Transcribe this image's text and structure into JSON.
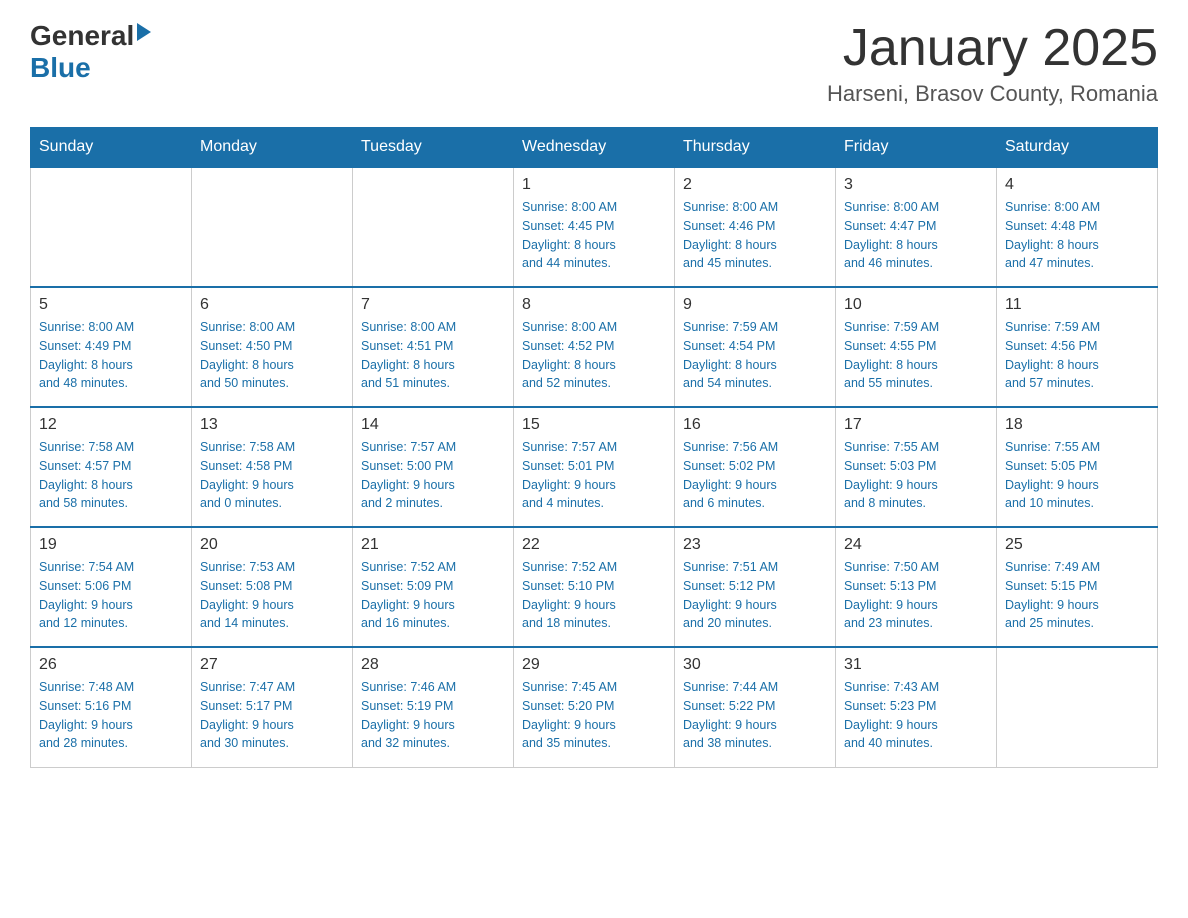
{
  "logo": {
    "general": "General",
    "blue": "Blue"
  },
  "title": "January 2025",
  "subtitle": "Harseni, Brasov County, Romania",
  "days_header": [
    "Sunday",
    "Monday",
    "Tuesday",
    "Wednesday",
    "Thursday",
    "Friday",
    "Saturday"
  ],
  "weeks": [
    [
      {
        "day": "",
        "info": ""
      },
      {
        "day": "",
        "info": ""
      },
      {
        "day": "",
        "info": ""
      },
      {
        "day": "1",
        "info": "Sunrise: 8:00 AM\nSunset: 4:45 PM\nDaylight: 8 hours\nand 44 minutes."
      },
      {
        "day": "2",
        "info": "Sunrise: 8:00 AM\nSunset: 4:46 PM\nDaylight: 8 hours\nand 45 minutes."
      },
      {
        "day": "3",
        "info": "Sunrise: 8:00 AM\nSunset: 4:47 PM\nDaylight: 8 hours\nand 46 minutes."
      },
      {
        "day": "4",
        "info": "Sunrise: 8:00 AM\nSunset: 4:48 PM\nDaylight: 8 hours\nand 47 minutes."
      }
    ],
    [
      {
        "day": "5",
        "info": "Sunrise: 8:00 AM\nSunset: 4:49 PM\nDaylight: 8 hours\nand 48 minutes."
      },
      {
        "day": "6",
        "info": "Sunrise: 8:00 AM\nSunset: 4:50 PM\nDaylight: 8 hours\nand 50 minutes."
      },
      {
        "day": "7",
        "info": "Sunrise: 8:00 AM\nSunset: 4:51 PM\nDaylight: 8 hours\nand 51 minutes."
      },
      {
        "day": "8",
        "info": "Sunrise: 8:00 AM\nSunset: 4:52 PM\nDaylight: 8 hours\nand 52 minutes."
      },
      {
        "day": "9",
        "info": "Sunrise: 7:59 AM\nSunset: 4:54 PM\nDaylight: 8 hours\nand 54 minutes."
      },
      {
        "day": "10",
        "info": "Sunrise: 7:59 AM\nSunset: 4:55 PM\nDaylight: 8 hours\nand 55 minutes."
      },
      {
        "day": "11",
        "info": "Sunrise: 7:59 AM\nSunset: 4:56 PM\nDaylight: 8 hours\nand 57 minutes."
      }
    ],
    [
      {
        "day": "12",
        "info": "Sunrise: 7:58 AM\nSunset: 4:57 PM\nDaylight: 8 hours\nand 58 minutes."
      },
      {
        "day": "13",
        "info": "Sunrise: 7:58 AM\nSunset: 4:58 PM\nDaylight: 9 hours\nand 0 minutes."
      },
      {
        "day": "14",
        "info": "Sunrise: 7:57 AM\nSunset: 5:00 PM\nDaylight: 9 hours\nand 2 minutes."
      },
      {
        "day": "15",
        "info": "Sunrise: 7:57 AM\nSunset: 5:01 PM\nDaylight: 9 hours\nand 4 minutes."
      },
      {
        "day": "16",
        "info": "Sunrise: 7:56 AM\nSunset: 5:02 PM\nDaylight: 9 hours\nand 6 minutes."
      },
      {
        "day": "17",
        "info": "Sunrise: 7:55 AM\nSunset: 5:03 PM\nDaylight: 9 hours\nand 8 minutes."
      },
      {
        "day": "18",
        "info": "Sunrise: 7:55 AM\nSunset: 5:05 PM\nDaylight: 9 hours\nand 10 minutes."
      }
    ],
    [
      {
        "day": "19",
        "info": "Sunrise: 7:54 AM\nSunset: 5:06 PM\nDaylight: 9 hours\nand 12 minutes."
      },
      {
        "day": "20",
        "info": "Sunrise: 7:53 AM\nSunset: 5:08 PM\nDaylight: 9 hours\nand 14 minutes."
      },
      {
        "day": "21",
        "info": "Sunrise: 7:52 AM\nSunset: 5:09 PM\nDaylight: 9 hours\nand 16 minutes."
      },
      {
        "day": "22",
        "info": "Sunrise: 7:52 AM\nSunset: 5:10 PM\nDaylight: 9 hours\nand 18 minutes."
      },
      {
        "day": "23",
        "info": "Sunrise: 7:51 AM\nSunset: 5:12 PM\nDaylight: 9 hours\nand 20 minutes."
      },
      {
        "day": "24",
        "info": "Sunrise: 7:50 AM\nSunset: 5:13 PM\nDaylight: 9 hours\nand 23 minutes."
      },
      {
        "day": "25",
        "info": "Sunrise: 7:49 AM\nSunset: 5:15 PM\nDaylight: 9 hours\nand 25 minutes."
      }
    ],
    [
      {
        "day": "26",
        "info": "Sunrise: 7:48 AM\nSunset: 5:16 PM\nDaylight: 9 hours\nand 28 minutes."
      },
      {
        "day": "27",
        "info": "Sunrise: 7:47 AM\nSunset: 5:17 PM\nDaylight: 9 hours\nand 30 minutes."
      },
      {
        "day": "28",
        "info": "Sunrise: 7:46 AM\nSunset: 5:19 PM\nDaylight: 9 hours\nand 32 minutes."
      },
      {
        "day": "29",
        "info": "Sunrise: 7:45 AM\nSunset: 5:20 PM\nDaylight: 9 hours\nand 35 minutes."
      },
      {
        "day": "30",
        "info": "Sunrise: 7:44 AM\nSunset: 5:22 PM\nDaylight: 9 hours\nand 38 minutes."
      },
      {
        "day": "31",
        "info": "Sunrise: 7:43 AM\nSunset: 5:23 PM\nDaylight: 9 hours\nand 40 minutes."
      },
      {
        "day": "",
        "info": ""
      }
    ]
  ]
}
